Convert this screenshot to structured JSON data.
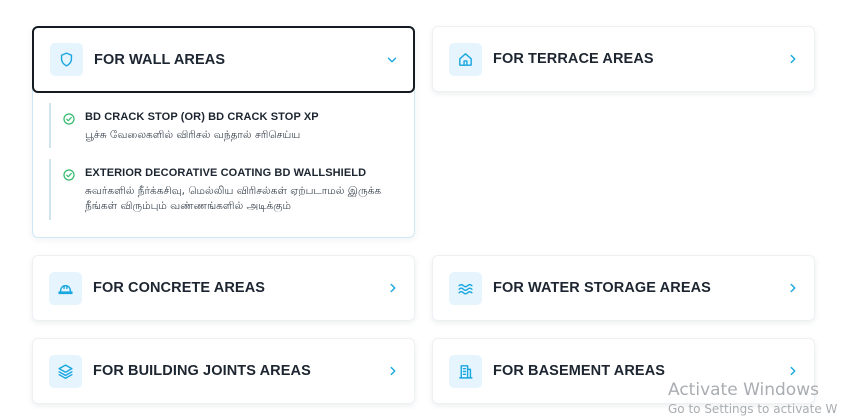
{
  "categories": [
    {
      "title": "FOR WALL AREAS",
      "icon": "shield-icon",
      "expanded": true
    },
    {
      "title": "FOR TERRACE AREAS",
      "icon": "house-icon",
      "expanded": false
    },
    {
      "title": "FOR CONCRETE AREAS",
      "icon": "hardhat-icon",
      "expanded": false
    },
    {
      "title": "FOR WATER STORAGE AREAS",
      "icon": "waves-icon",
      "expanded": false
    },
    {
      "title": "FOR BUILDING JOINTS AREAS",
      "icon": "layers-icon",
      "expanded": false
    },
    {
      "title": "FOR BASEMENT AREAS",
      "icon": "building-icon",
      "expanded": false
    }
  ],
  "wall_products": [
    {
      "name": "BD CRACK STOP (OR) BD CRACK STOP XP",
      "description": "பூச்சு வேலைகளில் விரிசல் வந்தால் சரிசெய்ய"
    },
    {
      "name": "EXTERIOR DECORATIVE COATING BD WALLSHIELD",
      "description": "சுவர்களில் நீர்க்கசிவு, மெல்லிய விரிசல்கள் ஏற்படாமல் இருக்க நீங்கள் விரும்பும் வண்ணங்களில் அடிக்கும்"
    }
  ],
  "watermark": {
    "line1": "Activate Windows",
    "line2": "Go to Settings to activate W"
  },
  "colors": {
    "accent": "#1aa7e0",
    "icon_bg": "#e6f5fd",
    "check": "#2fb86a",
    "active_border": "#141b22"
  }
}
